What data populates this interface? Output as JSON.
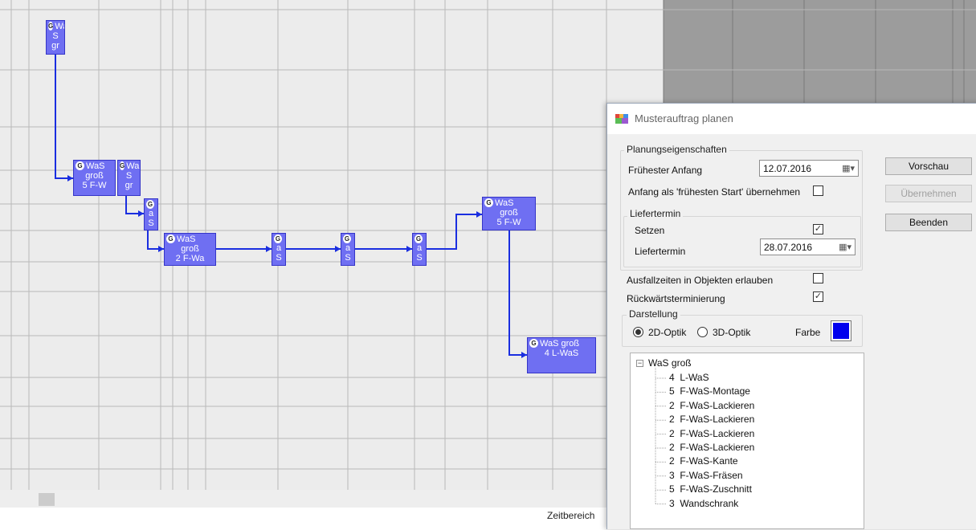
{
  "gantt": {
    "bars": [
      {
        "g": "G",
        "line1": "Wa",
        "rest": "S\ngr"
      },
      {
        "g": "G",
        "line1": "WaS",
        "rest": "groß\n5 F-W"
      },
      {
        "g": "G",
        "line1": "Wa",
        "rest": "S\ngr"
      },
      {
        "g": "G",
        "line1": "",
        "rest": "a\nS"
      },
      {
        "g": "G",
        "line1": "WaS",
        "rest": "groß\n2 F-Wa"
      },
      {
        "g": "G",
        "line1": "",
        "rest": "a\nS"
      },
      {
        "g": "G",
        "line1": "",
        "rest": "a\nS"
      },
      {
        "g": "G",
        "line1": "",
        "rest": "a\nS"
      },
      {
        "g": "G",
        "line1": "WaS",
        "rest": "groß\n5 F-W"
      },
      {
        "g": "G",
        "line1": "WaS groß",
        "rest": "4 L-WaS"
      }
    ],
    "colors": {
      "bar": "#6f6ff2",
      "link": "#1a2ee0",
      "grid": "#b9b9b9",
      "bg": "#ececec",
      "shaded": "#9c9c9c"
    },
    "footer_label": "Zeitbereich"
  },
  "dialog": {
    "title": "Musterauftrag planen",
    "planning": {
      "group_title": "Planungseigenschaften",
      "earliest_start_label": "Frühester Anfang",
      "earliest_start_value": "12.07.2016",
      "take_start_label": "Anfang als 'frühesten Start' übernehmen",
      "take_start_checked": false,
      "delivery": {
        "group_title": "Liefertermin",
        "set_label": "Setzen",
        "set_checked": true,
        "date_label": "Liefertermin",
        "date_value": "28.07.2016"
      }
    },
    "downtime_label": "Ausfallzeiten in Objekten erlauben",
    "downtime_checked": false,
    "backward_label": "Rückwärtsterminierung",
    "backward_checked": true,
    "display": {
      "group_title": "Darstellung",
      "opt_2d": "2D-Optik",
      "opt_3d": "3D-Optik",
      "selected": "2D-Optik",
      "color_label": "Farbe",
      "color": "#0000ee"
    },
    "buttons": {
      "preview": "Vorschau",
      "apply": "Übernehmen",
      "close": "Beenden"
    },
    "tree": {
      "root": "WaS groß",
      "children": [
        "4  L-WaS",
        "5  F-WaS-Montage",
        "2  F-WaS-Lackieren",
        "2  F-WaS-Lackieren",
        "2  F-WaS-Lackieren",
        "2  F-WaS-Lackieren",
        "2  F-WaS-Kante",
        "3  F-WaS-Fräsen",
        "5  F-WaS-Zuschnitt",
        "3  Wandschrank"
      ]
    }
  }
}
